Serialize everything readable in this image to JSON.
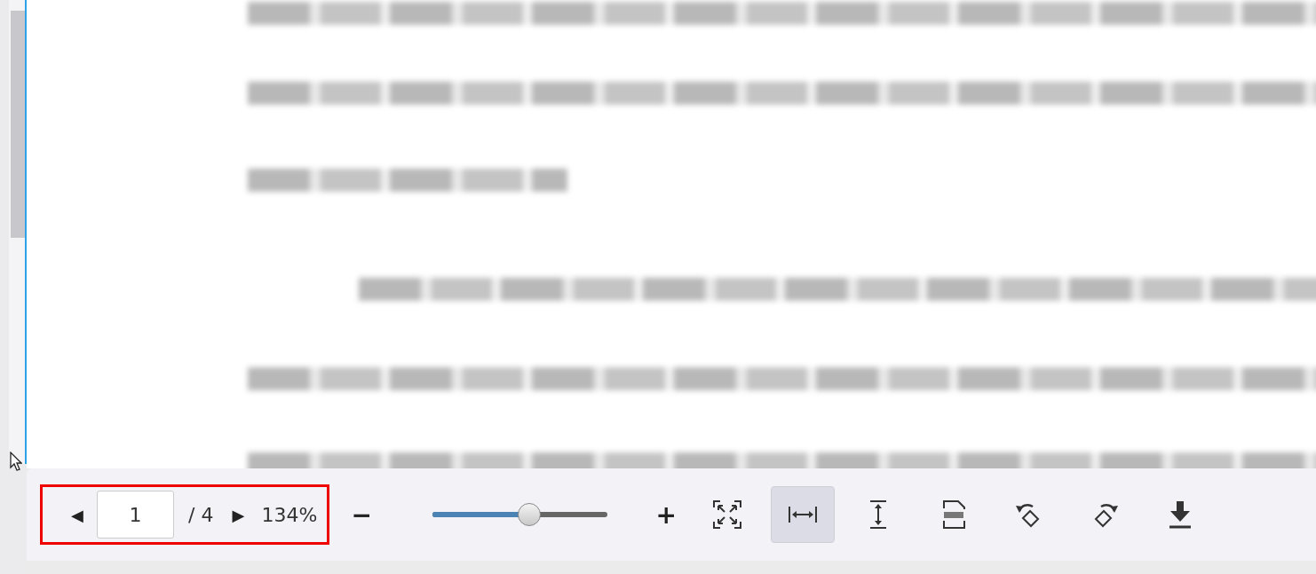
{
  "toolbar": {
    "prev_page": "◀",
    "page_input": {
      "value": "1"
    },
    "page_count": "/ 4",
    "next_page": "▶",
    "zoom_reading": "134%",
    "zoom_out": "−",
    "zoom_slider": {
      "level": 0.55
    },
    "zoom_in": "+",
    "view_buttons": [
      {
        "kind": "fit-page",
        "selected": false
      },
      {
        "kind": "fit-width",
        "selected": true
      },
      {
        "kind": "fit-height",
        "selected": false
      },
      {
        "kind": "actual-size",
        "selected": false
      }
    ],
    "actions": [
      {
        "kind": "rotate-left"
      },
      {
        "kind": "rotate-right"
      },
      {
        "kind": "download"
      }
    ],
    "highlight": {
      "on": true
    }
  }
}
